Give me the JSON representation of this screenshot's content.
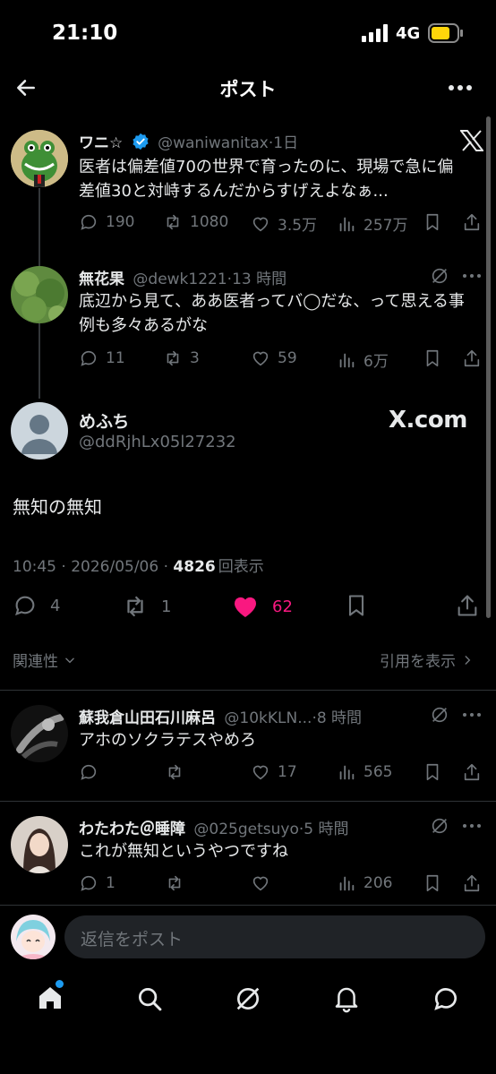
{
  "status_bar": {
    "time": "21:10",
    "network": "4G"
  },
  "header": {
    "title": "ポスト"
  },
  "thread": [
    {
      "name": "ワニ☆",
      "handle": "@waniwanitax",
      "time": "·1日",
      "verified": true,
      "text": "医者は偏差値70の世界で育ったのに、現場で急に偏差値30と対峙するんだからすげえよなぁ...",
      "stats": {
        "replies": "190",
        "reposts": "1080",
        "likes": "3.5万",
        "views": "257万"
      }
    },
    {
      "name": "無花果",
      "handle": "@dewk1221",
      "time": "·13 時間",
      "text": "底辺から見て、ああ医者ってバ◯だな、って思える事例も多々あるがな",
      "stats": {
        "replies": "11",
        "reposts": "3",
        "likes": "59",
        "views": "6万"
      }
    }
  ],
  "main_post": {
    "name": "めふち",
    "handle": "@ddRjhLx05l27232",
    "brand": "X.com",
    "text": "無知の無知",
    "timestamp": "10:45 · 2026/05/06 · ",
    "views": "4826",
    "views_label": "回表示",
    "stats": {
      "replies": "4",
      "reposts": "1",
      "likes": "62"
    }
  },
  "sort": {
    "relevance_label": "関連性",
    "quotes_label": "引用を表示"
  },
  "replies": [
    {
      "name": "蘇我倉山田石川麻呂",
      "handle": "@10kKLN...",
      "time": "·8 時間",
      "text": "アホのソクラテスやめろ",
      "stats": {
        "replies": "",
        "reposts": "",
        "likes": "17",
        "views": "565"
      }
    },
    {
      "name": "わたわた＠睡障",
      "handle": "@025getsuyo",
      "time": "·5 時間",
      "text": "これが無知というやつですね",
      "stats": {
        "replies": "1",
        "reposts": "",
        "likes": "",
        "views": "206"
      }
    }
  ],
  "composer": {
    "placeholder": "返信をポスト"
  },
  "colors": {
    "accent": "#1d9bf0",
    "like": "#f91880",
    "background": "#000000",
    "muted": "#71767b"
  }
}
